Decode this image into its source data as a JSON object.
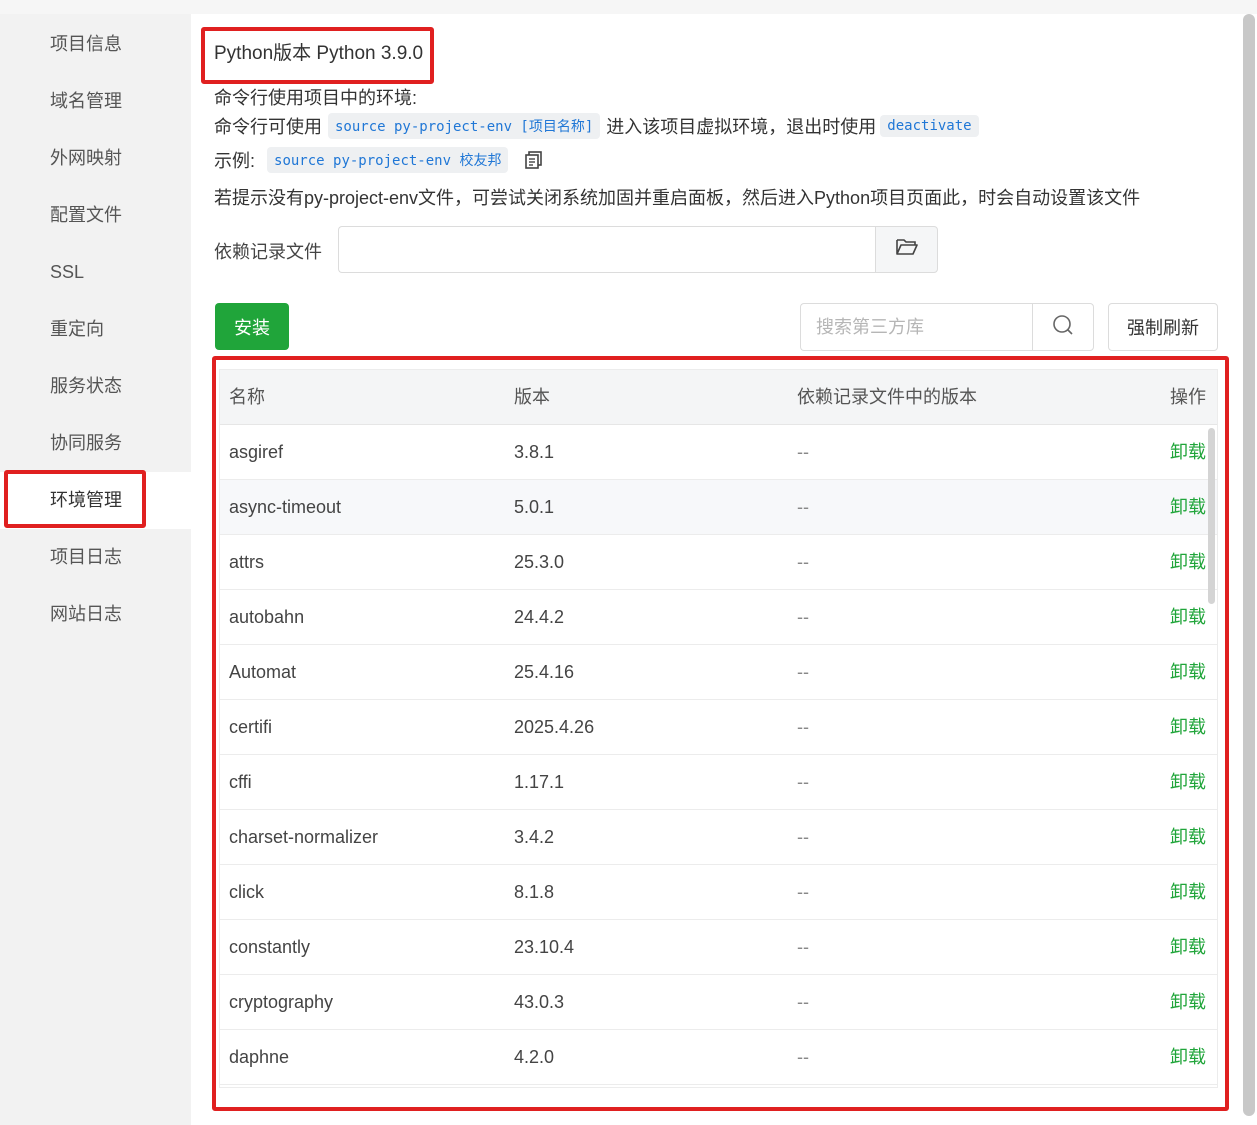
{
  "sidebar": {
    "items": [
      {
        "label": "项目信息"
      },
      {
        "label": "域名管理"
      },
      {
        "label": "外网映射"
      },
      {
        "label": "配置文件"
      },
      {
        "label": "SSL"
      },
      {
        "label": "重定向"
      },
      {
        "label": "服务状态"
      },
      {
        "label": "协同服务"
      },
      {
        "label": "环境管理"
      },
      {
        "label": "项目日志"
      },
      {
        "label": "网站日志"
      }
    ],
    "active": "环境管理"
  },
  "python_version": "Python版本 Python 3.9.0",
  "env_help": {
    "title": "命令行使用项目中的环境:",
    "line1_prefix": "命令行可使用",
    "line1_code": "source py-project-env [项目名称]",
    "line1_middle": "进入该项目虚拟环境，退出时使用",
    "line1_code2": "deactivate",
    "example_label": "示例:",
    "example_code": "source py-project-env 校友邦",
    "hint": "若提示没有py-project-env文件，可尝试关闭系统加固并重启面板，然后进入Python项目页面此，时会自动设置该文件"
  },
  "dependency_file": {
    "label": "依赖记录文件",
    "value": ""
  },
  "toolbar": {
    "install_label": "安装",
    "search_placeholder": "搜索第三方库",
    "refresh_label": "强制刷新"
  },
  "table": {
    "headers": [
      "名称",
      "版本",
      "依赖记录文件中的版本",
      "操作"
    ],
    "rows": [
      {
        "name": "asgiref",
        "version": "3.8.1",
        "dep_version": "--",
        "action": "卸载"
      },
      {
        "name": "async-timeout",
        "version": "5.0.1",
        "dep_version": "--",
        "action": "卸载"
      },
      {
        "name": "attrs",
        "version": "25.3.0",
        "dep_version": "--",
        "action": "卸载"
      },
      {
        "name": "autobahn",
        "version": "24.4.2",
        "dep_version": "--",
        "action": "卸载"
      },
      {
        "name": "Automat",
        "version": "25.4.16",
        "dep_version": "--",
        "action": "卸载"
      },
      {
        "name": "certifi",
        "version": "2025.4.26",
        "dep_version": "--",
        "action": "卸载"
      },
      {
        "name": "cffi",
        "version": "1.17.1",
        "dep_version": "--",
        "action": "卸载"
      },
      {
        "name": "charset-normalizer",
        "version": "3.4.2",
        "dep_version": "--",
        "action": "卸载"
      },
      {
        "name": "click",
        "version": "8.1.8",
        "dep_version": "--",
        "action": "卸载"
      },
      {
        "name": "constantly",
        "version": "23.10.4",
        "dep_version": "--",
        "action": "卸载"
      },
      {
        "name": "cryptography",
        "version": "43.0.3",
        "dep_version": "--",
        "action": "卸载"
      },
      {
        "name": "daphne",
        "version": "4.2.0",
        "dep_version": "--",
        "action": "卸载"
      }
    ]
  },
  "colors": {
    "accent_green": "#20a53a",
    "highlight_red": "#e02020",
    "code_blue": "#2077d6"
  },
  "icons": {
    "copy": "copy-icon",
    "folder": "folder-open-icon",
    "search": "search-icon"
  }
}
